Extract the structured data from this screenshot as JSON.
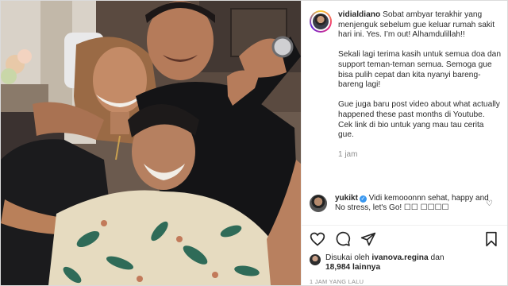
{
  "post": {
    "username": "vidialdiano",
    "caption_p1": "Sobat ambyar terakhir yang menjenguk sebelum gue keluar rumah sakit hari ini. Yes. I’m out! Alhamdulillah!!",
    "caption_p2": "Sekali lagi terima kasih untuk semua doa dan support teman-teman semua. Semoga gue bisa pulih cepat dan kita nyanyi bareng-bareng lagi!",
    "caption_p3": "Gue juga baru post video about what actually happened these past months di Youtube. Cek link di bio untuk yang mau tau cerita gue.",
    "time_ago": "1 jam"
  },
  "comment": {
    "username": "yukikt",
    "verified_mark": "✓",
    "text": "Vidi kemooonnn sehat, happy and No stress, let's Go! ☐☐ ☐☐☐☐"
  },
  "actions": {
    "icons": [
      "heart-icon",
      "comment-icon",
      "share-icon",
      "bookmark-icon"
    ]
  },
  "likes": {
    "prefix": "Disukai oleh",
    "user": "ivanova.regina",
    "connector": "dan",
    "count": "18,984",
    "suffix": "lainnya"
  },
  "post_time": "1 JAM YANG LALU",
  "colors": {
    "verified_blue": "#3897f0",
    "muted_gray": "#8e8e8e",
    "text": "#262626"
  }
}
